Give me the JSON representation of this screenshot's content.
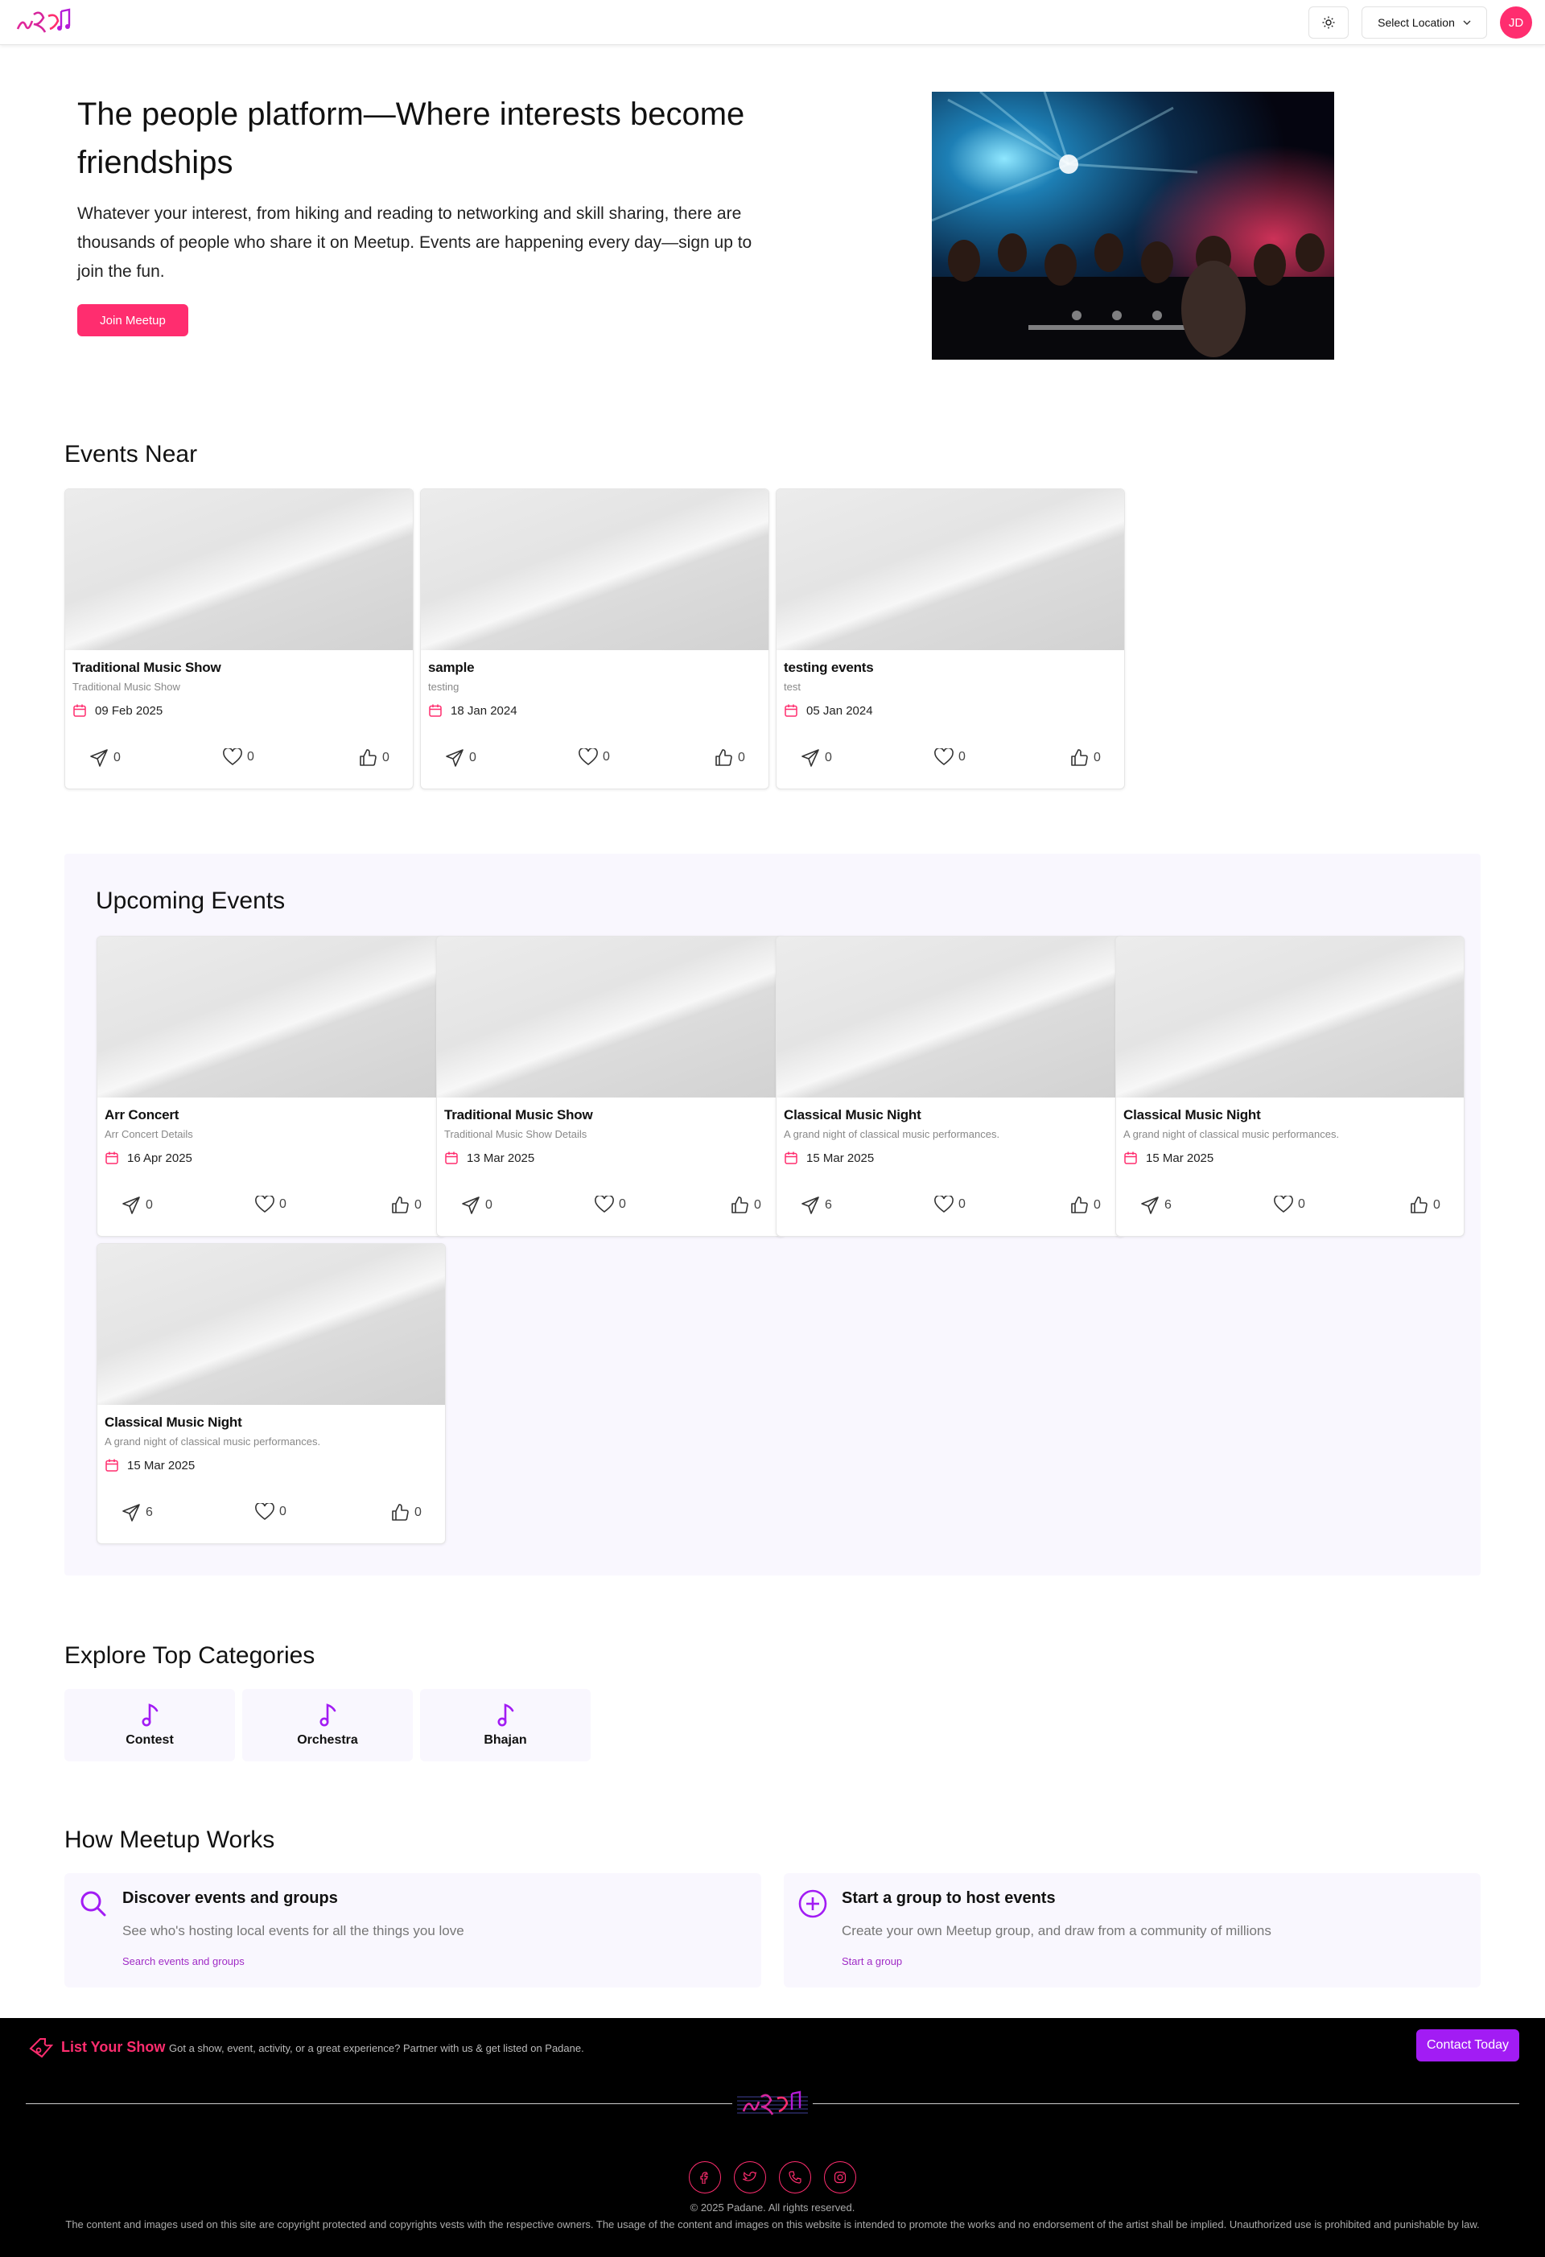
{
  "header": {
    "logo_alt": "Padane logo",
    "location_label": "Select Location",
    "avatar_initials": "JD"
  },
  "hero": {
    "title": "The people platform—Where interests become friendships",
    "text": "Whatever your interest, from hiking and reading to networking and skill sharing, there are thousands of people who share it on Meetup. Events are happening every day—sign up to join the fun.",
    "join_label": "Join Meetup"
  },
  "events_near": {
    "title": "Events Near",
    "cards": [
      {
        "title": "Traditional Music Show",
        "subtitle": "Traditional Music Show",
        "date": "09 Feb 2025",
        "shares": "0",
        "favorites": "0",
        "likes": "0"
      },
      {
        "title": "sample",
        "subtitle": "testing",
        "date": "18 Jan 2024",
        "shares": "0",
        "favorites": "0",
        "likes": "0"
      },
      {
        "title": "testing events",
        "subtitle": "test",
        "date": "05 Jan 2024",
        "shares": "0",
        "favorites": "0",
        "likes": "0"
      }
    ]
  },
  "upcoming": {
    "title": "Upcoming Events",
    "cards": [
      {
        "title": "Arr Concert",
        "subtitle": "Arr Concert Details",
        "date": "16 Apr 2025",
        "shares": "0",
        "favorites": "0",
        "likes": "0"
      },
      {
        "title": "Traditional Music Show",
        "subtitle": "Traditional Music Show Details",
        "date": "13 Mar 2025",
        "shares": "0",
        "favorites": "0",
        "likes": "0"
      },
      {
        "title": "Classical Music Night",
        "subtitle": "A grand night of classical music performances.",
        "date": "15 Mar 2025",
        "shares": "6",
        "favorites": "0",
        "likes": "0"
      },
      {
        "title": "Classical Music Night",
        "subtitle": "A grand night of classical music performances.",
        "date": "15 Mar 2025",
        "shares": "6",
        "favorites": "0",
        "likes": "0"
      },
      {
        "title": "Classical Music Night",
        "subtitle": "A grand night of classical music performances.",
        "date": "15 Mar 2025",
        "shares": "6",
        "favorites": "0",
        "likes": "0"
      }
    ]
  },
  "categories": {
    "title": "Explore Top Categories",
    "items": [
      {
        "label": "Contest",
        "icon": "music-note-icon"
      },
      {
        "label": "Orchestra",
        "icon": "music-note-icon"
      },
      {
        "label": "Bhajan",
        "icon": "music-note-icon"
      }
    ]
  },
  "how_it_works": {
    "title": "How Meetup Works",
    "items": [
      {
        "title": "Discover events and groups",
        "text": "See who's hosting local events for all the things you love",
        "link": "Search events and groups",
        "icon": "search-icon"
      },
      {
        "title": "Start a group to host events",
        "text": "Create your own Meetup group, and draw from a community of millions",
        "link": "Start a group",
        "icon": "plus-circle-icon"
      }
    ]
  },
  "footer": {
    "list_title": "List Your Show",
    "list_text": "Got a show, event, activity, or a great experience? Partner with us & get listed on Padane.",
    "contact_label": "Contact Today",
    "copyright": "© 2025 Padane. All rights reserved.",
    "disclaimer": "The content and images used on this site are copyright protected and copyrights vests with the respective owners. The usage of the content and images on this website is intended to promote the works and no endorsement of the artist shall be implied. Unauthorized use is prohibited and punishable by law."
  },
  "colors": {
    "brand_pink": "#ff2d6f",
    "accent_purple": "#a21cf4",
    "panel_bg": "#f9f7fe"
  }
}
